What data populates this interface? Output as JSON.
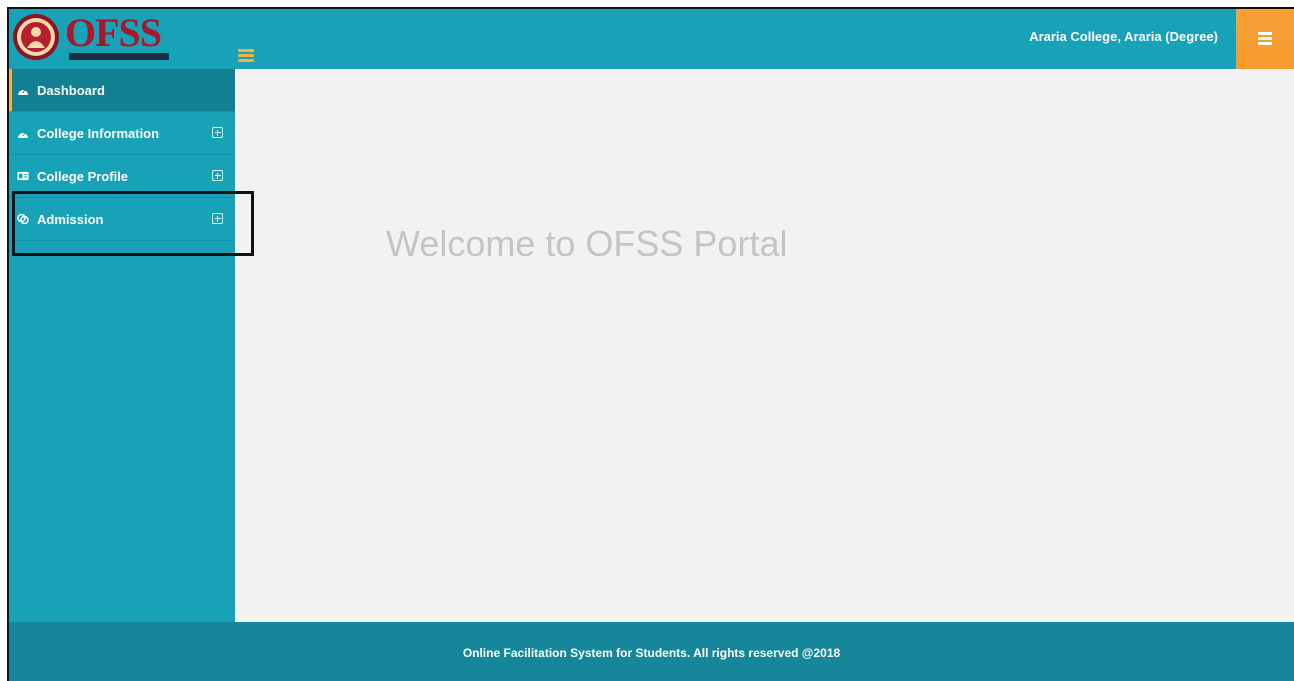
{
  "header": {
    "logo_text": "OFSS",
    "college_name": "Araria College, Araria (Degree)"
  },
  "sidebar": {
    "items": [
      {
        "label": "Dashboard",
        "icon": "dashboard-icon"
      },
      {
        "label": "College Information",
        "icon": "dashboard-icon"
      },
      {
        "label": "College Profile",
        "icon": "id-card-icon"
      },
      {
        "label": "Admission",
        "icon": "admission-icon"
      }
    ]
  },
  "main": {
    "welcome": "Welcome to OFSS Portal"
  },
  "footer": {
    "text": "Online Facilitation System for Students. All rights reserved @2018"
  },
  "colors": {
    "primary": "#17a2b8",
    "sidebar_active": "#118092",
    "accent_orange": "#f59a2c",
    "accent_yellow": "#f0b43a",
    "footer": "#16879b",
    "logo_red": "#a8172a"
  }
}
